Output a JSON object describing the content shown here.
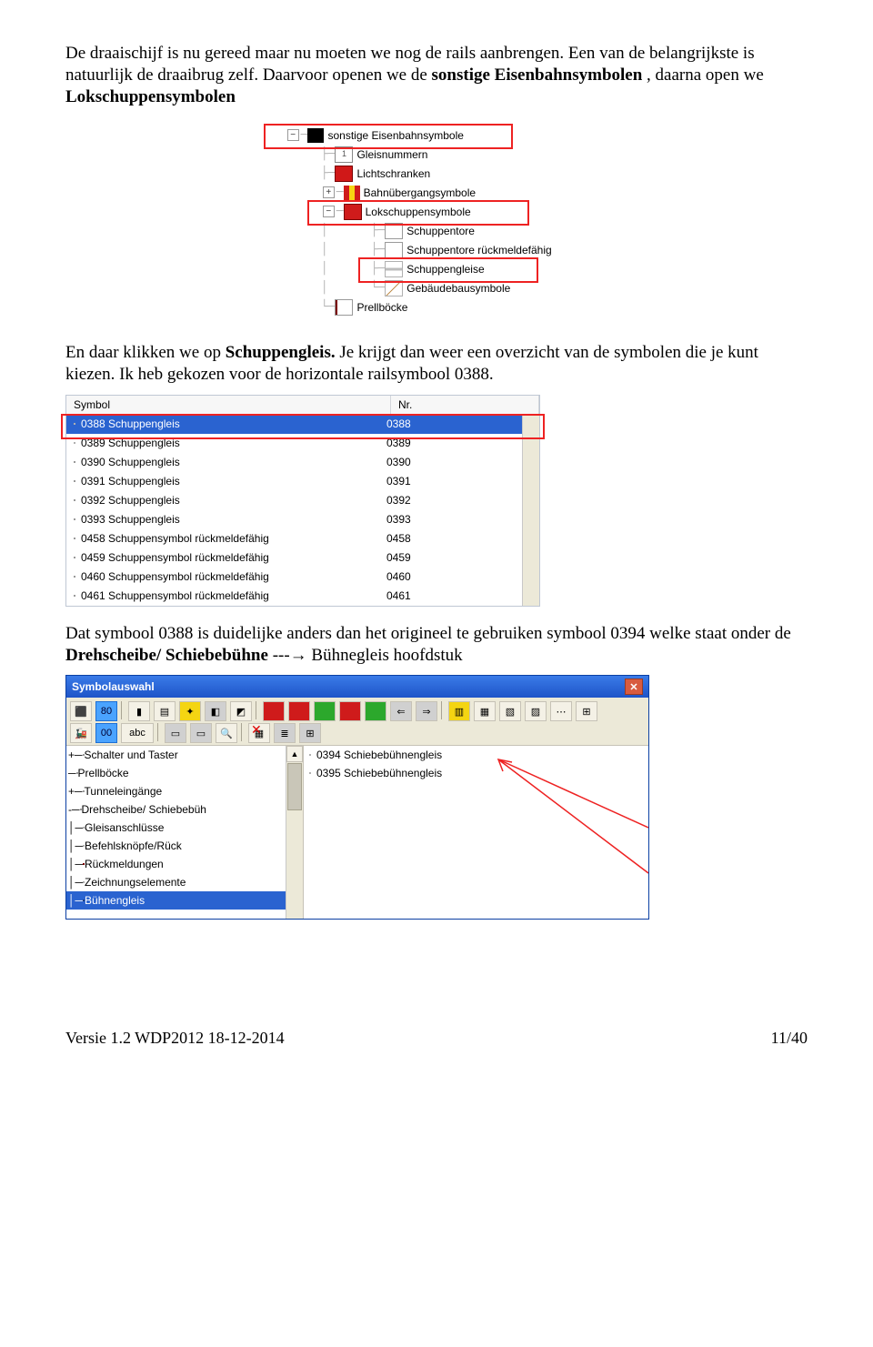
{
  "para1_a": "De draaischijf is nu gereed maar nu moeten we nog de rails aanbrengen. Een van de belangrijkste is natuurlijk de draaibrug zelf. Daarvoor openen we de ",
  "para1_b": "sonstige Eisenbahnsymbolen ",
  "para1_c": ", daarna open we ",
  "para1_d": "Lokschuppensymbolen",
  "tree": {
    "r0": "sonstige Eisenbahnsymbole",
    "r1": "Gleisnummern",
    "r2": "Lichtschranken",
    "r3": "Bahnübergangsymbole",
    "r4": "Lokschuppensymbole",
    "r5": "Schuppentore",
    "r6": "Schuppentore rückmeldefähig",
    "r7": "Schuppengleise",
    "r8": "Gebäudebausymbole",
    "r9": "Prellböcke"
  },
  "para2_a": "En daar klikken we op ",
  "para2_b": "Schuppengleis.",
  "para2_c": " Je krijgt dan weer een overzicht van de symbolen die je kunt kiezen. Ik heb gekozen voor de horizontale railsymbool 0388.",
  "list": {
    "h1": "Symbol",
    "h2": "Nr.",
    "rows": [
      {
        "label": "0388 Schuppengleis",
        "nr": "0388",
        "sel": true,
        "ic": "ic-hgleis"
      },
      {
        "label": "0389 Schuppengleis",
        "nr": "0389",
        "sel": false,
        "ic": "ic-vgleis"
      },
      {
        "label": "0390 Schuppengleis",
        "nr": "0390",
        "sel": false,
        "ic": "ic-schr"
      },
      {
        "label": "0391 Schuppengleis",
        "nr": "0391",
        "sel": false,
        "ic": "ic-schr"
      },
      {
        "label": "0392 Schuppengleis",
        "nr": "0392",
        "sel": false,
        "ic": "ic-schr"
      },
      {
        "label": "0393 Schuppengleis",
        "nr": "0393",
        "sel": false,
        "ic": "ic-schr"
      },
      {
        "label": "0458 Schuppensymbol rückmeldefähig",
        "nr": "0458",
        "sel": false,
        "ic": "ic-schr"
      },
      {
        "label": "0459 Schuppensymbol rückmeldefähig",
        "nr": "0459",
        "sel": false,
        "ic": "ic-schr"
      },
      {
        "label": "0460 Schuppensymbol rückmeldefähig",
        "nr": "0460",
        "sel": false,
        "ic": "ic-schr"
      },
      {
        "label": "0461 Schuppensymbol rückmeldefähig",
        "nr": "0461",
        "sel": false,
        "ic": "ic-schr"
      }
    ]
  },
  "para3_a": "Dat symbool 0388 is duidelijke anders dan het origineel te gebruiken symbool 0394 welke staat onder de ",
  "para3_b": "Drehscheibe/ Schiebebühne",
  "para3_c": " ---",
  "para3_d": " Bühnegleis hoofdstuk",
  "symwin": {
    "title": "Symbolauswahl",
    "left": [
      {
        "label": "Schalter und Taster",
        "pm": "+",
        "ic": "ic-sch"
      },
      {
        "label": "Prellböcke",
        "pm": "",
        "ic": "ic-prell"
      },
      {
        "label": "Tunneleingänge",
        "pm": "+",
        "ic": "ic-sch"
      },
      {
        "label": "Drehscheibe/ Schiebebüh",
        "pm": "-",
        "ic": "ic-sch"
      },
      {
        "label": "Gleisanschlüsse",
        "pm": "",
        "ic": "ic-gleis",
        "indent": true
      },
      {
        "label": "Befehlsknöpfe/Rück",
        "pm": "",
        "ic": "ic-bef",
        "indent": true
      },
      {
        "label": "Rückmeldungen",
        "pm": "",
        "ic": "ic-ruck",
        "indent": true
      },
      {
        "label": "Zeichnungselemente",
        "pm": "",
        "ic": "ic-zeich",
        "indent": true
      },
      {
        "label": "Bühnengleis",
        "pm": "",
        "ic": "ic-buhn",
        "indent": true,
        "sel": true
      }
    ],
    "right": [
      {
        "label": "0394 Schiebebühnengleis",
        "ic": "ic-hgleis"
      },
      {
        "label": "0395 Schiebebühnengleis",
        "ic": "ic-vgleis"
      }
    ],
    "tb2": [
      "abc"
    ]
  },
  "footer_l": "Versie 1.2 WDP2012 18-12-2014",
  "footer_r": "11/40"
}
